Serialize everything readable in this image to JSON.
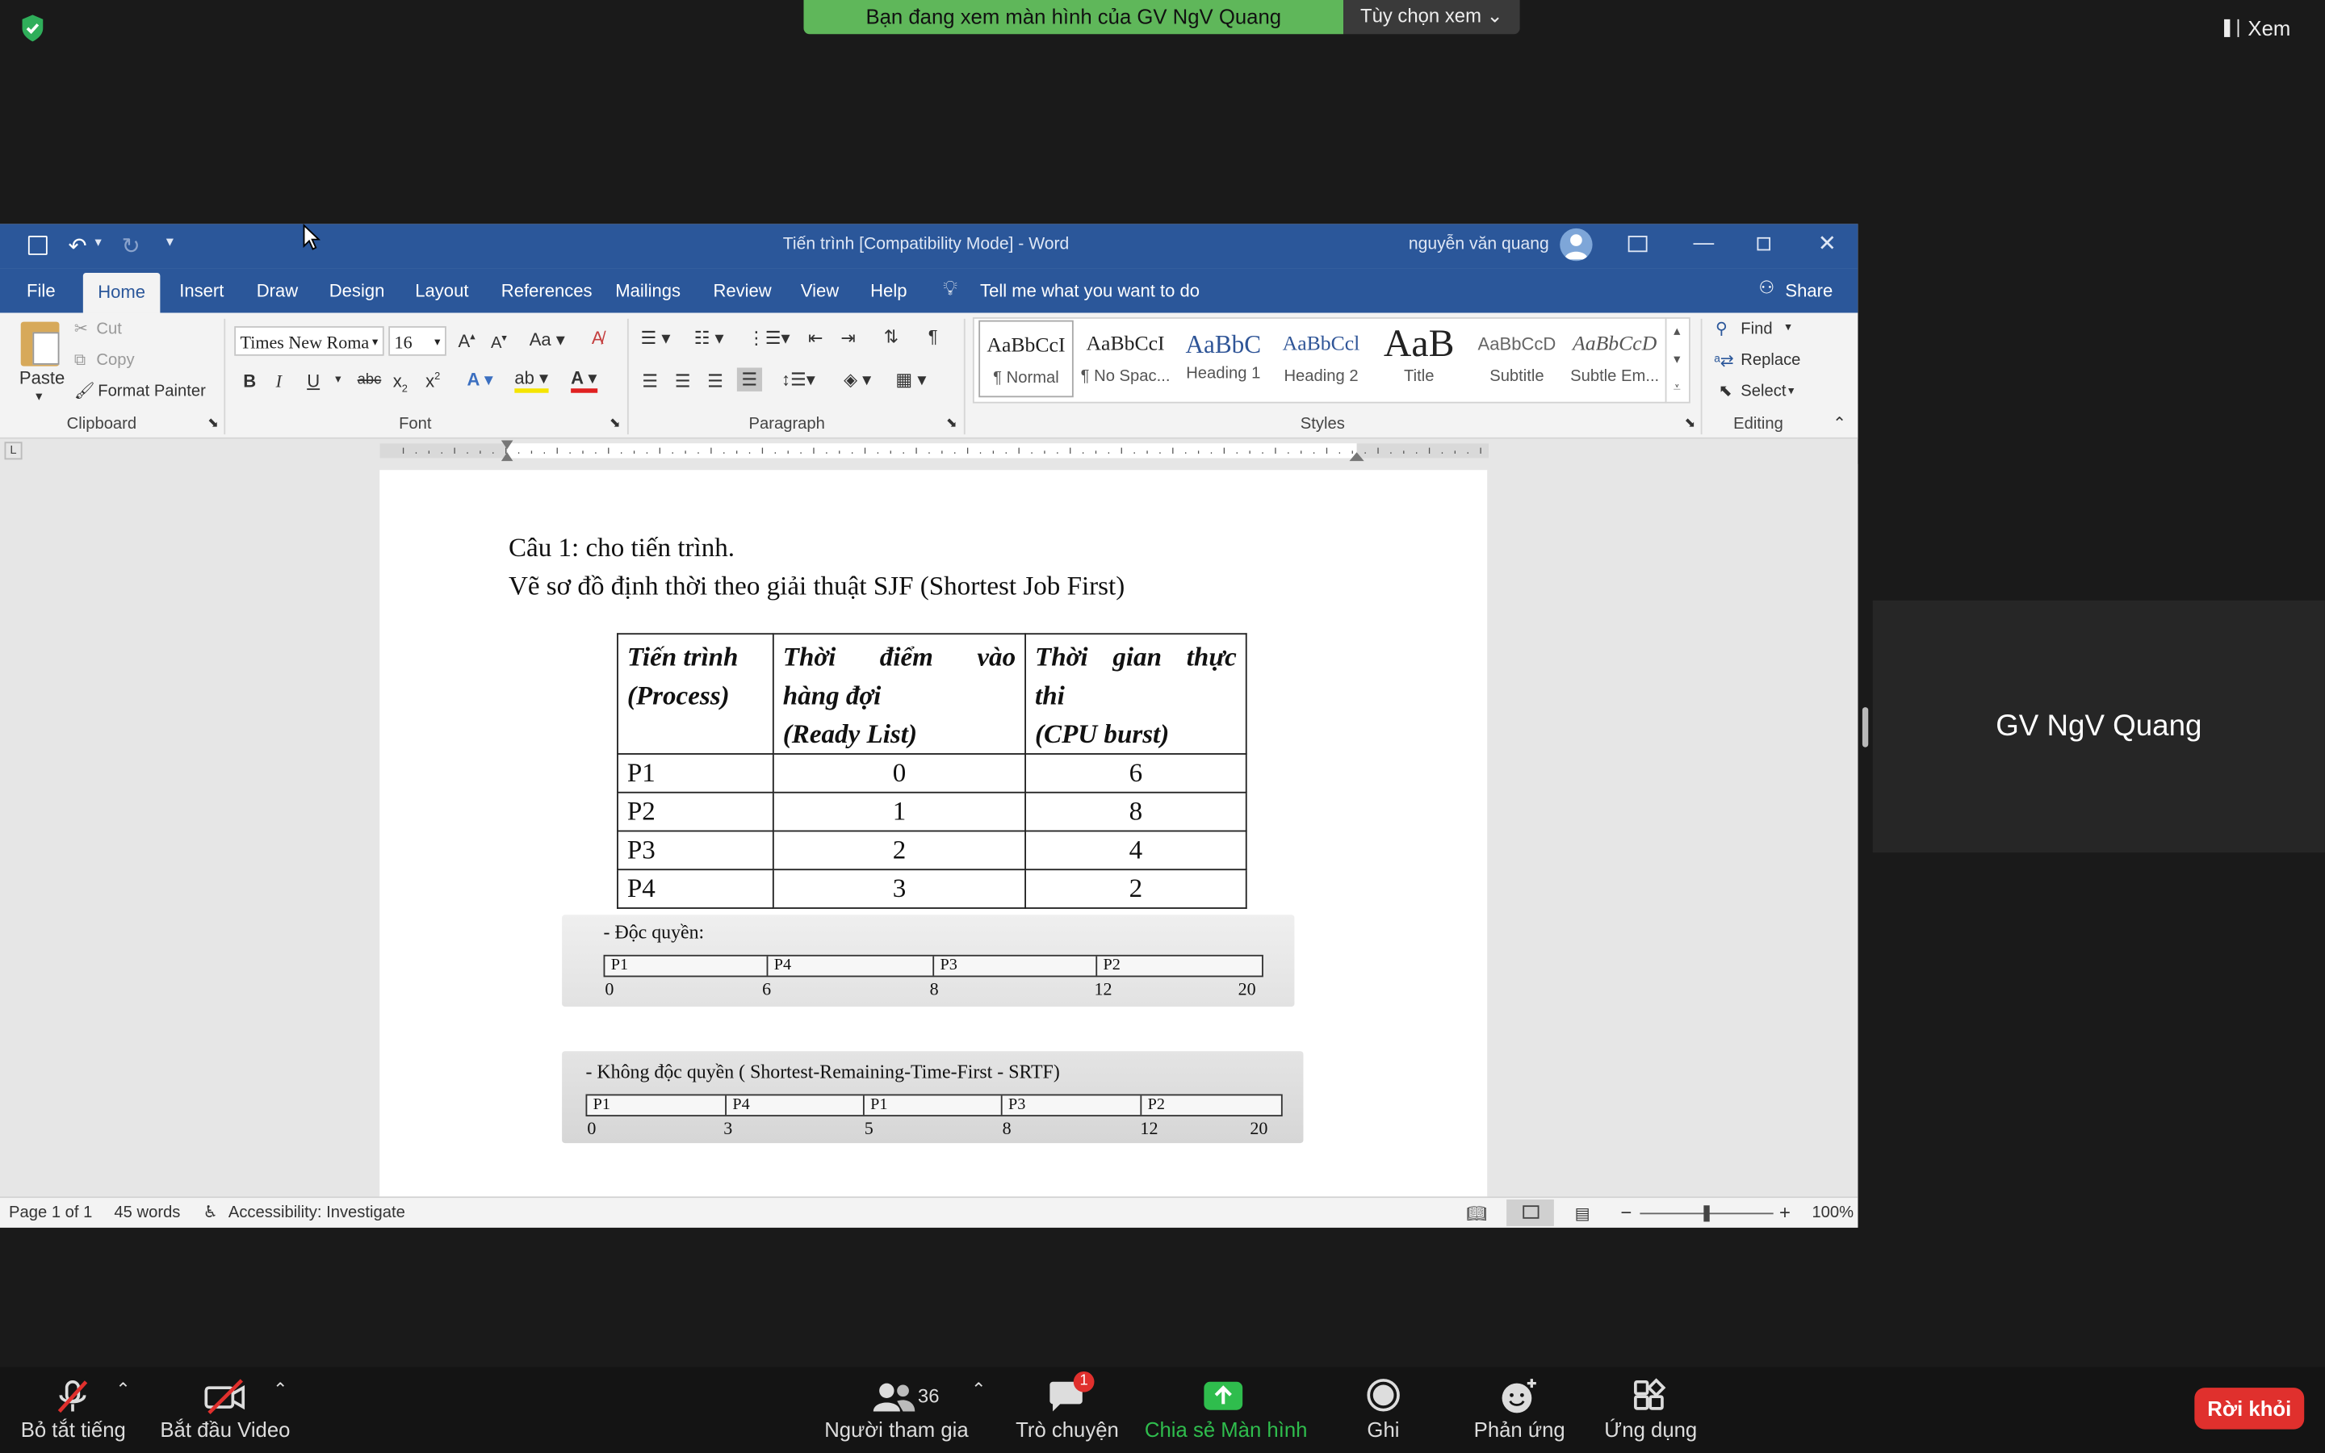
{
  "zoom": {
    "banner_text": "Bạn đang xem màn hình của GV NgV Quang",
    "view_options": "Tùy chọn xem",
    "view_button": "Xem",
    "participant_name": "GV NgV Quang",
    "toolbar": {
      "mute": "Bỏ tắt tiếng",
      "video": "Bắt đầu Video",
      "participants": "Người tham gia",
      "participants_count": "36",
      "chat": "Trò chuyện",
      "chat_badge": "1",
      "share": "Chia sẻ Màn hình",
      "record": "Ghi",
      "reactions": "Phản ứng",
      "apps": "Ứng dụng",
      "leave": "Rời khỏi"
    }
  },
  "word": {
    "title": "Tiến trình [Compatibility Mode]  -  Word",
    "user": "nguyễn văn quang",
    "tabs": [
      "File",
      "Home",
      "Insert",
      "Draw",
      "Design",
      "Layout",
      "References",
      "Mailings",
      "Review",
      "View",
      "Help"
    ],
    "tell_me": "Tell me what you want to do",
    "share": "Share",
    "clipboard": {
      "paste": "Paste",
      "cut": "Cut",
      "copy": "Copy",
      "format_painter": "Format Painter",
      "label": "Clipboard"
    },
    "font": {
      "name": "Times New Roma",
      "size": "16",
      "label": "Font"
    },
    "paragraph_label": "Paragraph",
    "styles": [
      {
        "sample": "AaBbCcI",
        "name": "¶ Normal"
      },
      {
        "sample": "AaBbCcI",
        "name": "¶ No Spac..."
      },
      {
        "sample": "AaBbC",
        "name": "Heading 1"
      },
      {
        "sample": "AaBbCcl",
        "name": "Heading 2"
      },
      {
        "sample": "AaB",
        "name": "Title"
      },
      {
        "sample": "AaBbCcD",
        "name": "Subtitle"
      },
      {
        "sample": "AaBbCcD",
        "name": "Subtle Em..."
      }
    ],
    "styles_label": "Styles",
    "editing": {
      "find": "Find",
      "replace": "Replace",
      "select": "Select",
      "label": "Editing"
    },
    "status": {
      "page": "Page 1 of 1",
      "words": "45 words",
      "accessibility": "Accessibility: Investigate",
      "zoom": "100%"
    }
  },
  "document": {
    "line1": "Câu 1: cho tiến trình.",
    "line2": "Vẽ sơ đồ định thời theo giải thuật SJF (Shortest Job First)",
    "table": {
      "headers": [
        [
          "Tiến trình",
          "(Process)"
        ],
        [
          "Thời điểm vào",
          "hàng đợi",
          "(Ready List)"
        ],
        [
          "Thời gian thực",
          "thi",
          "(CPU burst)"
        ]
      ],
      "rows": [
        [
          "P1",
          "0",
          "6"
        ],
        [
          "P2",
          "1",
          "8"
        ],
        [
          "P3",
          "2",
          "4"
        ],
        [
          "P4",
          "3",
          "2"
        ]
      ]
    },
    "gantt1": {
      "title": "-    Độc quyền:",
      "blocks": [
        "P1",
        "P4",
        "P3",
        "P2"
      ],
      "ticks": [
        "0",
        "6",
        "8",
        "12",
        "20"
      ]
    },
    "gantt2": {
      "title": "-    Không độc quyền ( Shortest-Remaining-Time-First  - SRTF)",
      "blocks": [
        "P1",
        "P4",
        "P1",
        "P3",
        "P2"
      ],
      "ticks": [
        "0",
        "3",
        "5",
        "8",
        "12",
        "20"
      ]
    }
  }
}
